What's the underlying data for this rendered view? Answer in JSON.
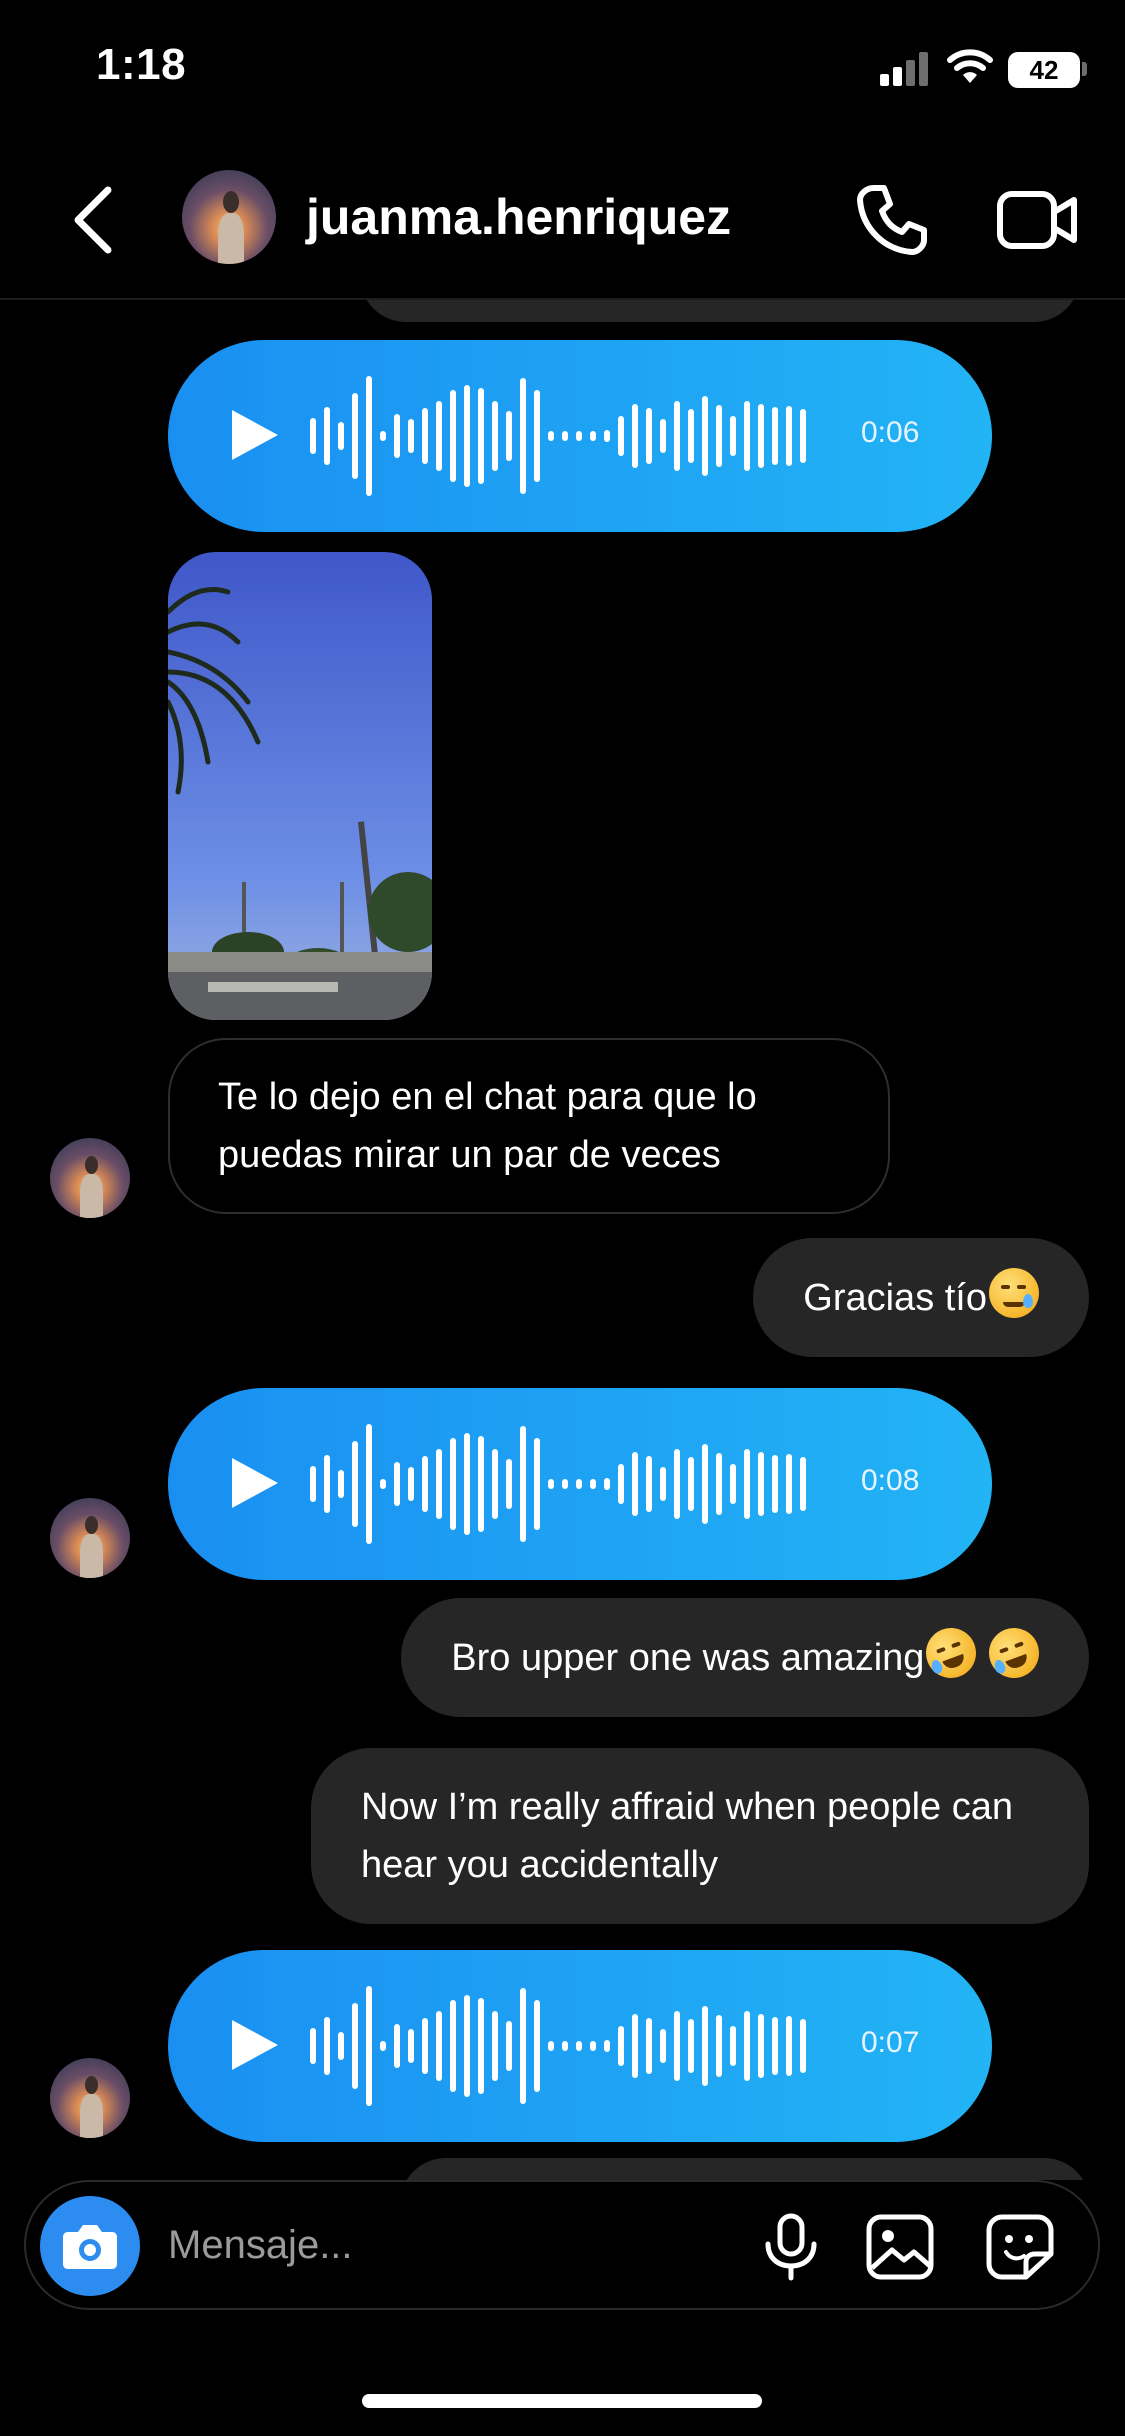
{
  "status_bar": {
    "time": "1:18",
    "battery": "42"
  },
  "header": {
    "username": "juanma.henriquez"
  },
  "messages": {
    "voice_1": {
      "duration": "0:06"
    },
    "text_in_1": "Te lo dejo en el chat para que lo puedas mirar un par de veces",
    "text_out_1": "Gracias tío",
    "voice_2": {
      "duration": "0:08"
    },
    "text_out_2": "Bro upper one was amazing",
    "text_out_3": "Now I’m really affraid when people can hear you accidentally",
    "voice_3": {
      "duration": "0:07"
    }
  },
  "composer": {
    "placeholder": "Mensaje..."
  },
  "colors": {
    "accent": "#1a8ff2",
    "bubble_out": "#262626",
    "camera_button": "#2d8cf0"
  }
}
